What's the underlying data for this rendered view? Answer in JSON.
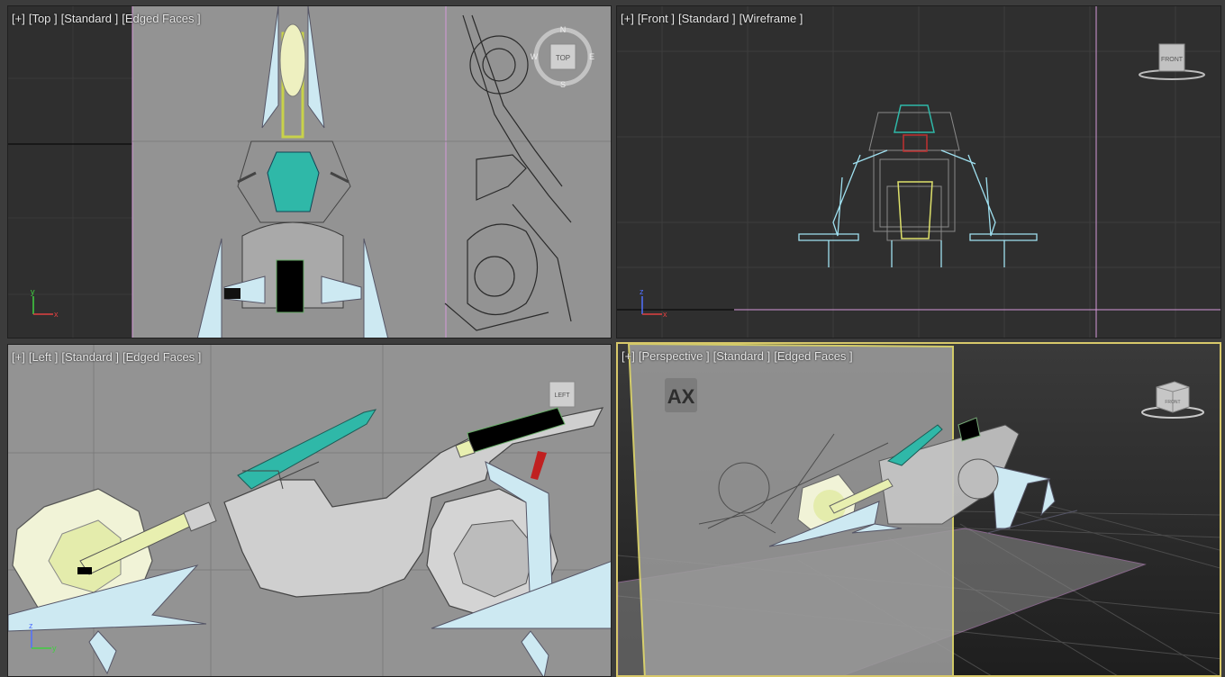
{
  "viewports": {
    "top": {
      "plus": "[+]",
      "view": "[Top ]",
      "shading_mode": "[Standard ]",
      "display": "[Edged Faces ]",
      "viewcube_label": "TOP",
      "compass": {
        "n": "N",
        "e": "E",
        "s": "S",
        "w": "W"
      }
    },
    "front": {
      "plus": "[+]",
      "view": "[Front ]",
      "shading_mode": "[Standard ]",
      "display": "[Wireframe ]",
      "viewcube_label": "FRONT"
    },
    "left": {
      "plus": "[+]",
      "view": "[Left ]",
      "shading_mode": "[Standard ]",
      "display": "[Edged Faces ]",
      "viewcube_label": "LEFT"
    },
    "perspective": {
      "plus": "[+]",
      "view": "[Perspective ]",
      "shading_mode": "[Standard ]",
      "display": "[Edged Faces ]",
      "viewcube_label": "FRONT",
      "plane_logo": "AX"
    }
  },
  "axes": {
    "x": "x",
    "y": "y",
    "z": "z"
  },
  "colors": {
    "viewport_bg_ortho": "#2f2f2f",
    "reference_plane": "#939393",
    "active_border": "#d8c86a",
    "model_teal": "#2fb8a8",
    "model_ice": "#cde9f2",
    "model_yellow": "#e8efb0",
    "axis_x": "#e04040",
    "axis_y": "#40d040",
    "axis_z": "#5070ff"
  }
}
